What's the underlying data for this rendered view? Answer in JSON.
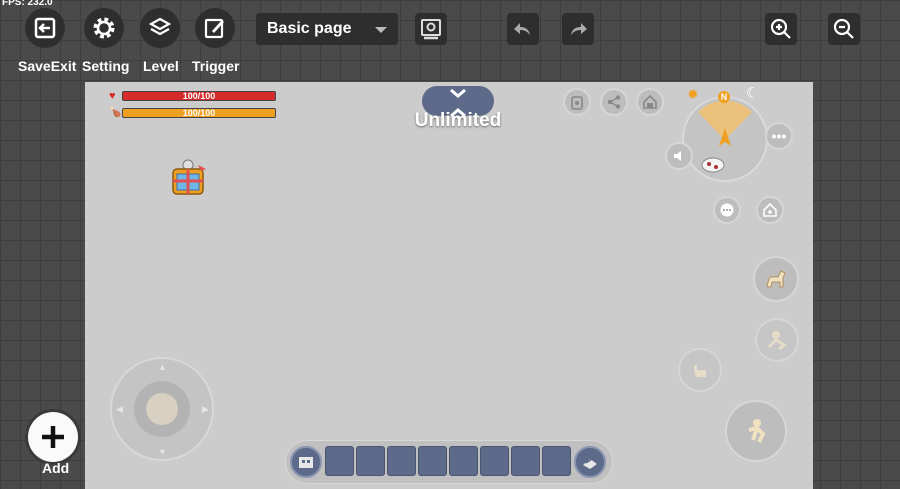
{
  "fps": "FPS: 232.0",
  "toolbar": {
    "save_exit_label": "SaveExit",
    "setting_label": "Setting",
    "level_label": "Level",
    "trigger_label": "Trigger",
    "page_select_value": "Basic page"
  },
  "add_label": "Add",
  "game": {
    "health_text": "100/100",
    "hunger_text": "100/100",
    "health_fraction": 1.0,
    "hunger_fraction": 1.0,
    "mode_label": "Unlimited",
    "compass_north": "N",
    "hotbar_slot_count": 8
  },
  "colors": {
    "health": "#d62b2b",
    "hunger": "#f0a020",
    "hotbar_slot": "#5d6a8a"
  }
}
